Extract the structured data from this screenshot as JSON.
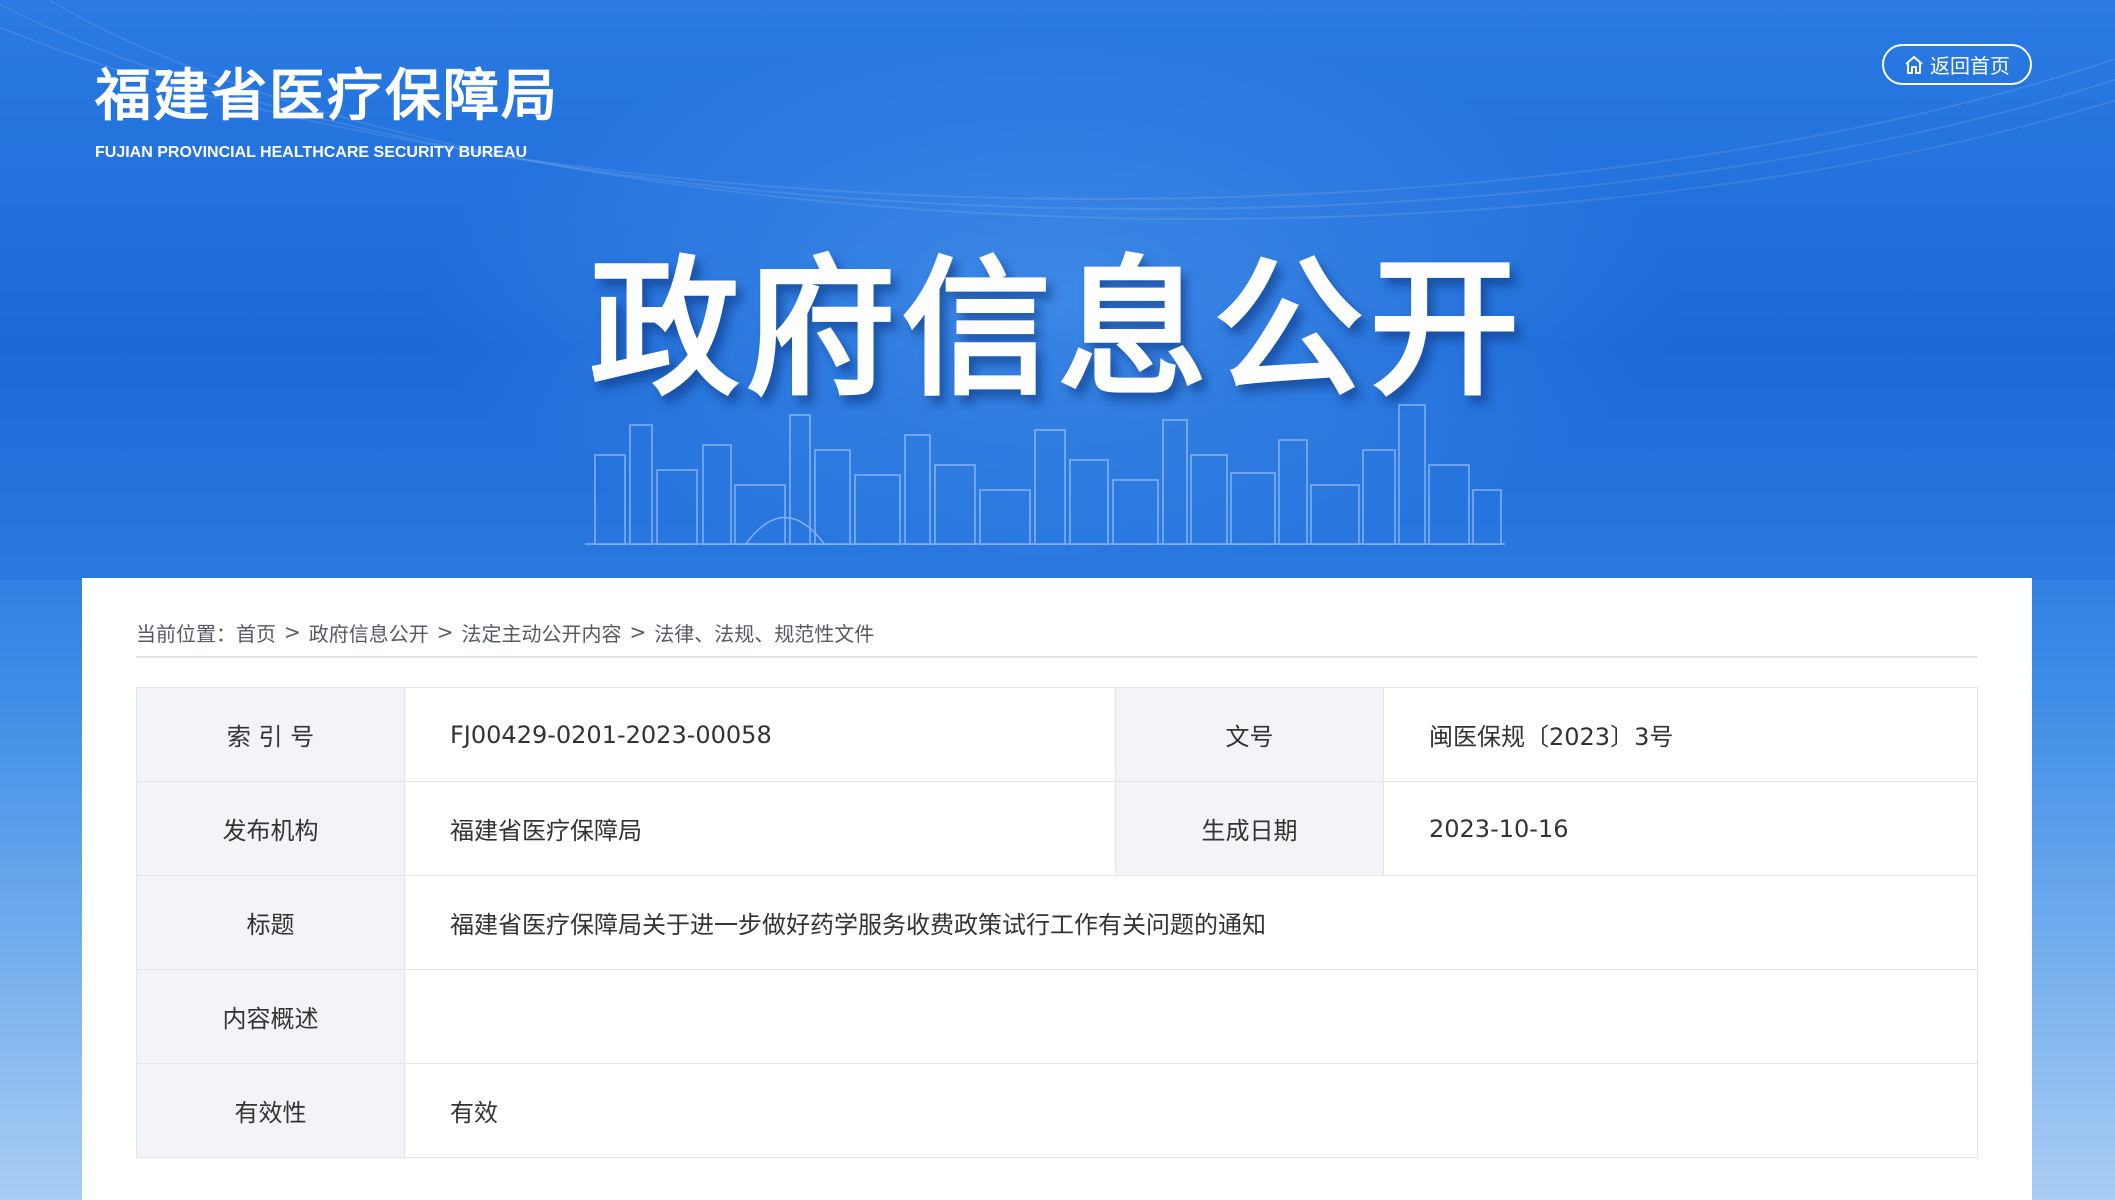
{
  "header": {
    "logo_cn": "福建省医疗保障局",
    "logo_en": "FUJIAN PROVINCIAL HEALTHCARE SECURITY BUREAU",
    "home_button": "返回首页",
    "headline": "政府信息公开"
  },
  "breadcrumb": {
    "prefix": "当前位置：",
    "items": [
      "首页",
      "政府信息公开",
      "法定主动公开内容",
      "法律、法规、规范性文件"
    ],
    "separator": ">"
  },
  "info_table": {
    "index_label": "索 引 号",
    "index_value": "FJ00429-0201-2023-00058",
    "docno_label": "文号",
    "docno_value": "闽医保规〔2023〕3号",
    "publisher_label": "发布机构",
    "publisher_value": "福建省医疗保障局",
    "date_label": "生成日期",
    "date_value": "2023-10-16",
    "title_label": "标题",
    "title_value": "福建省医疗保障局关于进一步做好药学服务收费政策试行工作有关问题的通知",
    "summary_label": "内容概述",
    "summary_value": "",
    "validity_label": "有效性",
    "validity_value": "有效"
  },
  "colors": {
    "banner_blue": "#1f6fde",
    "label_bg": "#f2f4f8",
    "border": "#e2e5ea"
  },
  "icons": {
    "home": "home-icon"
  }
}
